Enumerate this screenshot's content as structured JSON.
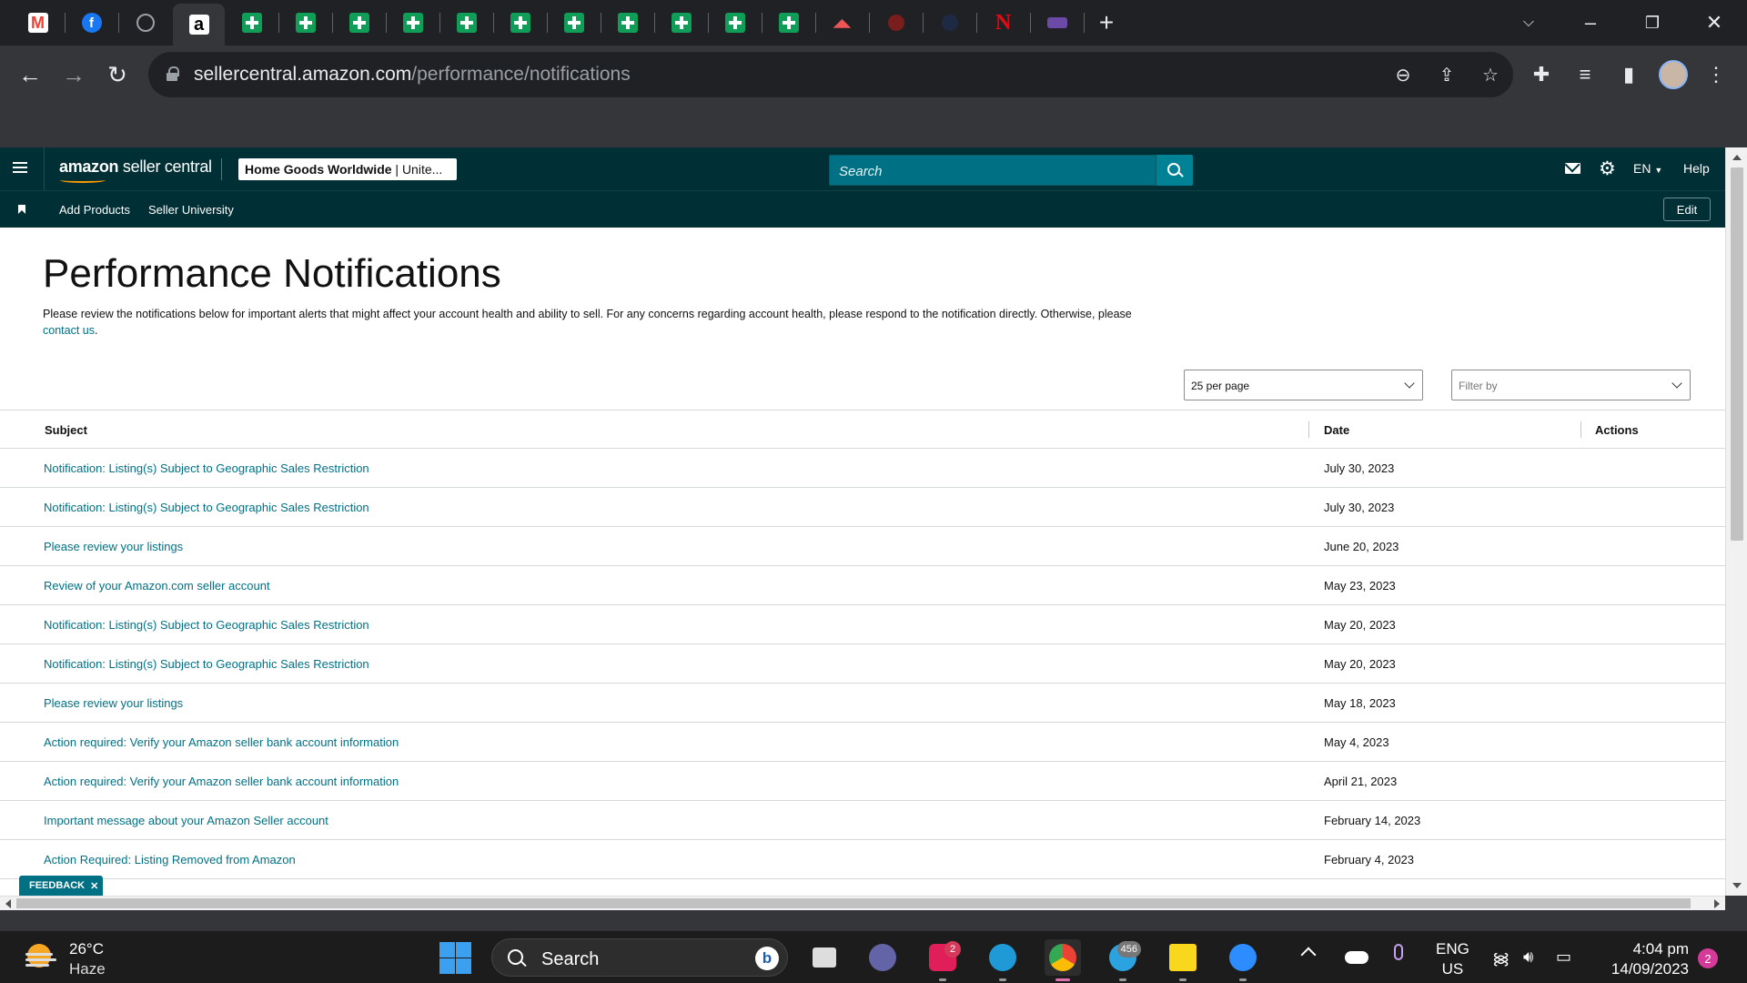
{
  "browser": {
    "url_host": "sellercentral.amazon.com",
    "url_path": "/performance/notifications"
  },
  "seller_central": {
    "brand_bold": "amazon",
    "brand_rest": " seller central",
    "account_name": "Home Goods Worldwide",
    "account_region": " | Unite...",
    "search_placeholder": "Search",
    "language": "EN",
    "help_label": "Help",
    "nav_links": [
      "Add Products",
      "Seller University"
    ],
    "edit_label": "Edit"
  },
  "page": {
    "title": "Performance Notifications",
    "intro_text": "Please review the notifications below for important alerts that might affect your account health and ability to sell. For any concerns regarding account health, please respond to the notification directly. Otherwise, please",
    "contact_link": "contact us",
    "intro_end": ".",
    "per_page_value": "25 per page",
    "filter_placeholder": "Filter by",
    "columns": {
      "subject": "Subject",
      "date": "Date",
      "actions": "Actions"
    },
    "notifications": [
      {
        "subject": "Notification: Listing(s) Subject to Geographic Sales Restriction",
        "date": "July 30, 2023"
      },
      {
        "subject": "Notification: Listing(s) Subject to Geographic Sales Restriction",
        "date": "July 30, 2023"
      },
      {
        "subject": "Please review your listings",
        "date": "June 20, 2023"
      },
      {
        "subject": "Review of your Amazon.com seller account",
        "date": "May 23, 2023"
      },
      {
        "subject": "Notification: Listing(s) Subject to Geographic Sales Restriction",
        "date": "May 20, 2023"
      },
      {
        "subject": "Notification: Listing(s) Subject to Geographic Sales Restriction",
        "date": "May 20, 2023"
      },
      {
        "subject": "Please review your listings",
        "date": "May 18, 2023"
      },
      {
        "subject": "Action required: Verify your Amazon seller bank account information",
        "date": "May 4, 2023"
      },
      {
        "subject": "Action required: Verify your Amazon seller bank account information",
        "date": "April 21, 2023"
      },
      {
        "subject": "Important message about your Amazon Seller account",
        "date": "February 14, 2023"
      },
      {
        "subject": "Action Required: Listing Removed from Amazon",
        "date": "February 4, 2023"
      }
    ],
    "feedback_label": "FEEDBACK"
  },
  "taskbar": {
    "temperature": "26°C",
    "weather": "Haze",
    "search_label": "Search",
    "slack_badge": "2",
    "telegram_badge": "456",
    "language_line1": "ENG",
    "language_line2": "US",
    "time": "4:04 pm",
    "date": "14/09/2023",
    "notification_count": "2"
  }
}
